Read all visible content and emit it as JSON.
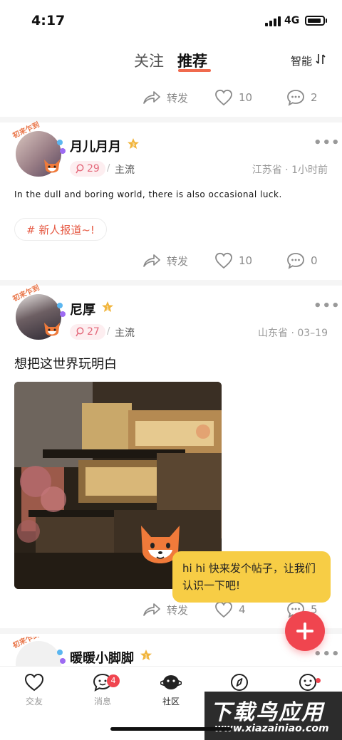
{
  "status": {
    "time": "4:17",
    "network": "4G"
  },
  "header": {
    "tab_follow": "关注",
    "tab_recommend": "推荐",
    "sort_label": "智能"
  },
  "top_actions": {
    "share": "转发",
    "likes": "10",
    "comments": "2"
  },
  "posts": [
    {
      "avatar_badge": "初来乍到",
      "username": "月儿月月",
      "level": "3",
      "likes": "29",
      "category": "主流",
      "location": "江苏省 · 1小时前",
      "text": "In the dull and boring world, there is also occasional luck.",
      "hashtag": "# 新人报道~!",
      "actions": {
        "share": "转发",
        "likes": "10",
        "comments": "0"
      }
    },
    {
      "avatar_badge": "初来乍到",
      "username": "尼厚",
      "level": "1",
      "likes": "27",
      "category": "主流",
      "location": "山东省 · 03–19",
      "text": "想把这世界玩明白",
      "actions": {
        "share": "转发",
        "likes": "4",
        "comments": "5"
      }
    },
    {
      "avatar_badge": "初来乍到",
      "username": "暖暖小脚脚",
      "level": "1"
    }
  ],
  "toast": {
    "text": "hi hi 快来发个帖子，让我们认识一下吧!"
  },
  "bottom_nav": {
    "items": [
      {
        "label": "交友"
      },
      {
        "label": "消息",
        "badge": "4"
      },
      {
        "label": "社区"
      },
      {
        "label": "发现"
      },
      {
        "label": "我的"
      }
    ]
  },
  "watermark": {
    "title": "下载鸟应用",
    "url": "www.xiazainiao.com"
  },
  "colors": {
    "accent": "#f06a4e",
    "fab": "#f0454f",
    "toast": "#f7cd45",
    "like_badge_bg": "#fdeef0"
  }
}
